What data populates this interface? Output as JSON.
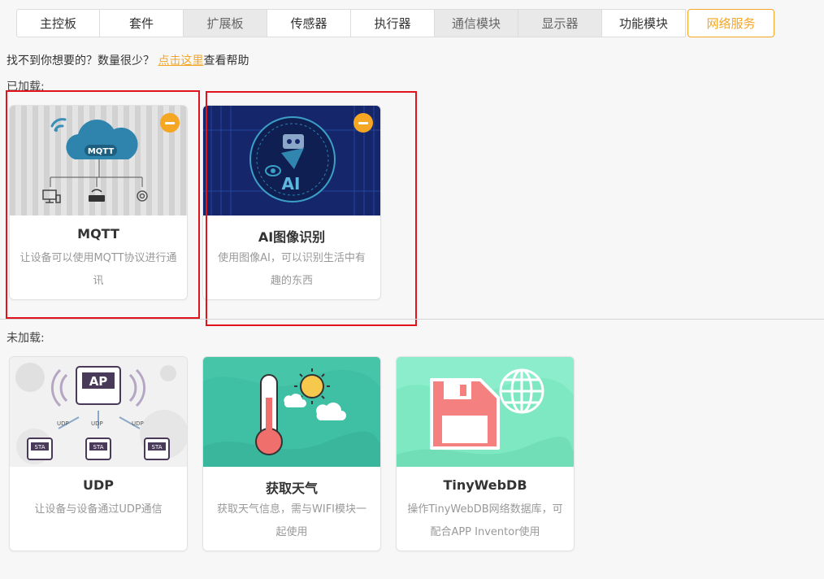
{
  "tabs": [
    {
      "label": "主控板",
      "state": "normal"
    },
    {
      "label": "套件",
      "state": "normal"
    },
    {
      "label": "扩展板",
      "state": "dim"
    },
    {
      "label": "传感器",
      "state": "normal"
    },
    {
      "label": "执行器",
      "state": "normal"
    },
    {
      "label": "通信模块",
      "state": "dim"
    },
    {
      "label": "显示器",
      "state": "dim"
    },
    {
      "label": "功能模块",
      "state": "normal"
    },
    {
      "label": "网络服务",
      "state": "active"
    }
  ],
  "help": {
    "prefix": "找不到你想要的？数量很少？",
    "link": "点击这里",
    "suffix": "查看帮助"
  },
  "loaded": {
    "label": "已加载:",
    "cards": [
      {
        "title": "MQTT",
        "desc": "让设备可以使用MQTT协议进行通讯",
        "image_text": "MQTT"
      },
      {
        "title": "AI图像识别",
        "desc": "使用图像AI，可以识别生活中有趣的东西",
        "image_text": "AI"
      }
    ]
  },
  "unloaded": {
    "label": "未加载:",
    "cards": [
      {
        "title": "UDP",
        "desc": "让设备与设备通过UDP通信",
        "image_text": {
          "ap": "AP",
          "udp": "UDP",
          "sta": "STA"
        }
      },
      {
        "title": "获取天气",
        "desc": "获取天气信息，需与WIFI模块一起使用"
      },
      {
        "title": "TinyWebDB",
        "desc": "操作TinyWebDB网络数据库，可配合APP Inventor使用"
      }
    ]
  },
  "colors": {
    "accent": "#f5a623",
    "highlight": "#e0141c",
    "weather_bg": "#3fbfa3",
    "tinywebdb_bg": "#7ee8c3",
    "ai_bg": "#1a2a6c"
  }
}
